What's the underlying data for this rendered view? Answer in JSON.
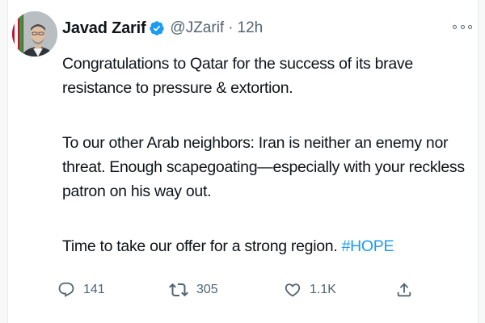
{
  "tweet": {
    "author": {
      "display_name": "Javad Zarif",
      "handle": "@JZarif",
      "verified": true
    },
    "separator": "·",
    "timestamp": "12h",
    "paragraphs": [
      {
        "text": "Congratulations to Qatar for the success of its brave resistance to pressure & extortion."
      },
      {
        "text": "To our other Arab neighbors: Iran is neither an enemy nor threat. Enough scapegoating—especially with your reckless patron on his way out."
      },
      {
        "text": "Time to take our offer for a strong region. ",
        "hashtag": "#HOPE"
      }
    ],
    "actions": {
      "replies": "141",
      "retweets": "305",
      "likes": "1.1K"
    }
  },
  "icons": [
    "verified-badge-icon",
    "more-options-icon",
    "reply-icon",
    "retweet-icon",
    "like-icon",
    "share-icon"
  ],
  "colors": {
    "text": "#0f1419",
    "secondary": "#536471",
    "accent": "#1d9bf0",
    "background": "#ffffff"
  }
}
